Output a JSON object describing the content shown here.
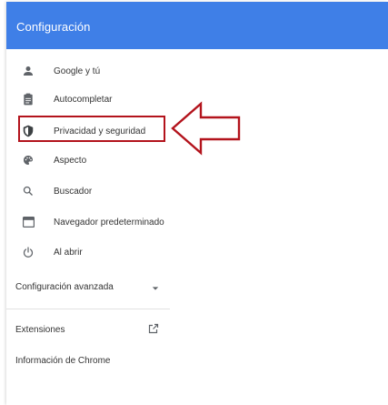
{
  "header": {
    "title": "Configuración"
  },
  "sidebar": {
    "items": [
      {
        "label": "Google y tú",
        "icon": "person-icon"
      },
      {
        "label": "Autocompletar",
        "icon": "clipboard-icon"
      },
      {
        "label": "Privacidad y seguridad",
        "icon": "shield-icon"
      },
      {
        "label": "Aspecto",
        "icon": "palette-icon"
      },
      {
        "label": "Buscador",
        "icon": "search-icon"
      },
      {
        "label": "Navegador predeterminado",
        "icon": "browser-icon"
      },
      {
        "label": "Al abrir",
        "icon": "power-icon"
      }
    ],
    "advanced": {
      "label": "Configuración avanzada",
      "icon": "chevron-down-icon"
    },
    "extensions": {
      "label": "Extensiones",
      "icon": "open-in-new-icon"
    },
    "about": {
      "label": "Información de Chrome"
    }
  },
  "annotation": {
    "highlight_color": "#b3131c",
    "highlighted_item": "Privacidad y seguridad"
  },
  "colors": {
    "header_bg": "#3f7fe7",
    "icon": "#5f6368",
    "text": "#333333"
  }
}
